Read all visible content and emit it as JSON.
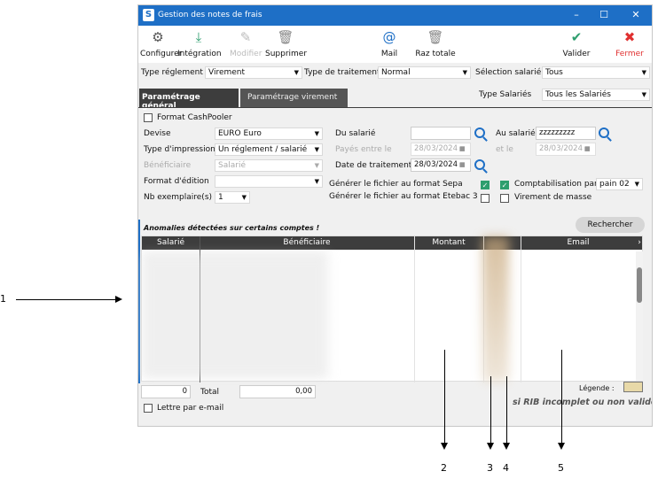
{
  "window": {
    "title": "Gestion des notes de frais",
    "logo": "S"
  },
  "toolbar": {
    "configurer": "Configurer",
    "integration": "Intégration",
    "modifier": "Modifier",
    "supprimer": "Supprimer",
    "mail": "Mail",
    "raz": "Raz totale",
    "valider": "Valider",
    "fermer": "Fermer"
  },
  "filters": {
    "type_reglement_label": "Type réglement",
    "type_reglement_value": "Virement",
    "type_traitement_label": "Type de traitement",
    "type_traitement_value": "Normal",
    "selection_salarie_label": "Sélection salarié",
    "selection_salarie_value": "Tous",
    "type_salaries_label": "Type Salariés",
    "type_salaries_value": "Tous les Salariés"
  },
  "tabs": {
    "general": "Paramétrage général",
    "virement": "Paramétrage virement"
  },
  "form": {
    "format_cashpooler": "Format CashPooler",
    "devise_label": "Devise",
    "devise_value": "EURO Euro",
    "type_impression_label": "Type d'impression",
    "type_impression_value": "Un réglement / salarié",
    "beneficiaire_label": "Bénéficiaire",
    "beneficiaire_value": "Salarié",
    "format_edition_label": "Format d'édition",
    "format_edition_value": "",
    "nb_exemplaires_label": "Nb exemplaire(s)",
    "nb_exemplaires_value": "1",
    "du_salarie_label": "Du salarié",
    "au_salarie_label": "Au salarié",
    "au_salarie_value": "zzzzzzzzz",
    "payes_entre_label": "Payés entre le",
    "payes_entre_value": "28/03/2024",
    "et_le_label": "et le",
    "et_le_value": "28/03/2024",
    "date_traitement_label": "Date de traitement",
    "date_traitement_value": "28/03/2024",
    "sepa_label": "Générer le fichier au format Sepa",
    "etebac_label": "Générer le fichier au format Etebac 3",
    "comptabilisation_label": "Comptabilisation par",
    "comptabilisation_value": "pain 02",
    "virement_masse_label": "Virement de masse"
  },
  "grid": {
    "anomalies_text": "Anomalies détectées sur certains comptes !",
    "rechercher": "Rechercher",
    "columns": {
      "salarie": "Salarié",
      "beneficiaire": "Bénéficiaire",
      "montant": "Montant",
      "email": "Email"
    }
  },
  "footer": {
    "count": "0",
    "total_label": "Total",
    "total_value": "0,00",
    "legende": "Légende :",
    "lettre_email": "Lettre par e-mail",
    "rib_note": "si RIB incomplet ou non validé"
  },
  "annotations": {
    "a1": "1",
    "a2": "2",
    "a3": "3",
    "a4": "4",
    "a5": "5"
  },
  "colors": {
    "titlebar": "#1e6fc6",
    "tab_active": "#3d3d3d",
    "check": "#2e9e6e",
    "close": "#e03030"
  }
}
